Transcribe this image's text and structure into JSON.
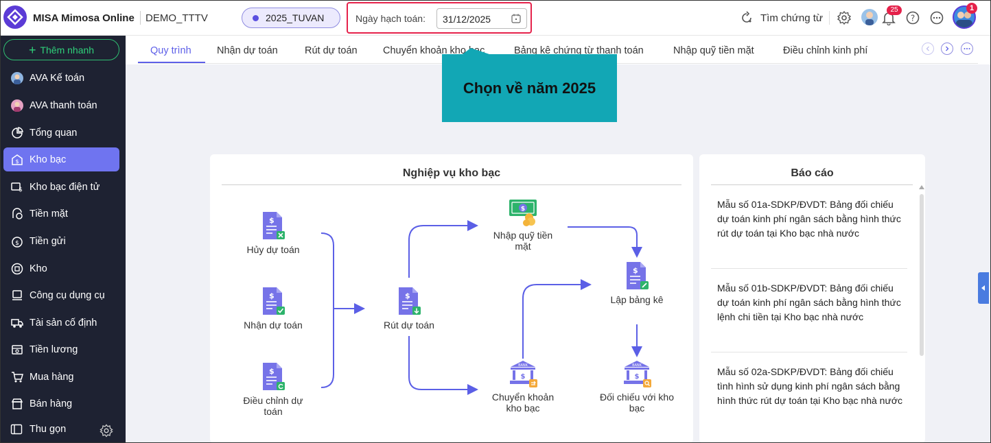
{
  "header": {
    "app_name": "MISA Mimosa Online",
    "org": "DEMO_TTTV",
    "year": "2025_TUVAN",
    "date_label": "Ngày hạch toán:",
    "date_value": "31/12/2025",
    "search_label": "Tìm chứng từ",
    "notification_count": "25",
    "profile_badge": "1"
  },
  "sidebar": {
    "quick_add": "Thêm nhanh",
    "items": [
      {
        "label": "AVA Kế toán",
        "icon": "ava-avatar-icon"
      },
      {
        "label": "AVA thanh toán",
        "icon": "ava-pay-avatar-icon"
      },
      {
        "label": "Tổng quan",
        "icon": "pie-chart-icon"
      },
      {
        "label": "Kho bạc",
        "icon": "treasury-icon"
      },
      {
        "label": "Kho bạc điện tử",
        "icon": "e-treasury-icon"
      },
      {
        "label": "Tiền mặt",
        "icon": "cash-icon"
      },
      {
        "label": "Tiền gửi",
        "icon": "deposit-icon"
      },
      {
        "label": "Kho",
        "icon": "warehouse-icon"
      },
      {
        "label": "Công cụ dụng cụ",
        "icon": "tools-icon"
      },
      {
        "label": "Tài sản cố định",
        "icon": "truck-icon"
      },
      {
        "label": "Tiền lương",
        "icon": "salary-icon"
      },
      {
        "label": "Mua hàng",
        "icon": "cart-icon"
      },
      {
        "label": "Bán hàng",
        "icon": "store-icon"
      }
    ],
    "collapse": "Thu gọn"
  },
  "tabs": [
    "Quy trình",
    "Nhận dự toán",
    "Rút dự toán",
    "Chuyển khoản kho bạc",
    "Bảng kê chứng từ thanh toán",
    "Nhập quỹ tiền mặt",
    "Điều chỉnh kinh phí"
  ],
  "callout": "Chọn về năm 2025",
  "workflow": {
    "title": "Nghiệp vụ kho bạc",
    "nodes": {
      "huy_du_toan": "Hủy dự toán",
      "nhan_du_toan": "Nhận dự toán",
      "dieu_chinh_du_toan": "Điều chỉnh dự toán",
      "rut_du_toan": "Rút dự toán",
      "nhap_quy_tien_mat": "Nhập quỹ tiền mặt",
      "chuyen_khoan_kho_bac": "Chuyển khoản kho bạc",
      "lap_bang_ke": "Lập bảng kê",
      "doi_chieu_kho_bac": "Đối chiếu với kho bạc"
    }
  },
  "reports": {
    "title": "Báo cáo",
    "items": [
      "Mẫu số 01a-SDKP/ĐVDT: Bảng đối chiếu dự toán kinh phí ngân sách bằng hình thức rút dự toán tại Kho bạc nhà nước",
      "Mẫu số 01b-SDKP/ĐVDT: Bảng đối chiếu dự toán kinh phí ngân sách bằng hình thức lệnh chi tiền tại Kho bạc nhà nước",
      "Mẫu số 02a-SDKP/ĐVDT: Bảng đối chiếu tình hình sử dụng kinh phí ngân sách bằng hình thức rút dự toán tại Kho bạc nhà nước"
    ]
  },
  "colors": {
    "accent": "#5d5fe8",
    "sidebar_bg": "#1e2232",
    "active_nav": "#6f74f0",
    "callout": "#12a7b5",
    "highlight_border": "#e5214a",
    "quick_add": "#2fd17a"
  }
}
